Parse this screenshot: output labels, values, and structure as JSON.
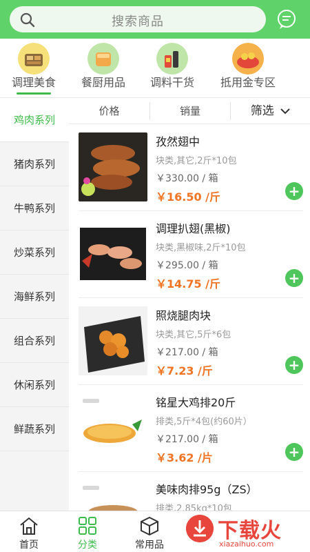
{
  "header": {
    "search_placeholder": "搜索商品"
  },
  "categories": [
    {
      "label": "调理美食",
      "active": true
    },
    {
      "label": "餐厨用品",
      "active": false
    },
    {
      "label": "调料干货",
      "active": false
    },
    {
      "label": "抵用金专区",
      "active": false
    }
  ],
  "sidebar": {
    "items": [
      {
        "label": "鸡肉系列",
        "active": true
      },
      {
        "label": "猪肉系列",
        "active": false
      },
      {
        "label": "牛鸭系列",
        "active": false
      },
      {
        "label": "炒菜系列",
        "active": false
      },
      {
        "label": "海鲜系列",
        "active": false
      },
      {
        "label": "组合系列",
        "active": false
      },
      {
        "label": "休闲系列",
        "active": false
      },
      {
        "label": "鲜蔬系列",
        "active": false
      }
    ]
  },
  "sortbar": {
    "price": "价格",
    "sales": "销量",
    "filter": "筛选"
  },
  "products": [
    {
      "name": "孜然翅中",
      "spec": "块类,其它,2斤*10包",
      "box_price": "￥330.00 / 箱",
      "unit_price": "￥16.50 /斤"
    },
    {
      "name": "调理扒翅(黑椒)",
      "spec": "块类,黑椒味,2斤*10包",
      "box_price": "￥295.00 / 箱",
      "unit_price": "￥14.75 /斤"
    },
    {
      "name": "照烧腿肉块",
      "spec": "块类,其它,5斤*6包",
      "box_price": "￥217.00 / 箱",
      "unit_price": "￥7.23 /斤"
    },
    {
      "name": "铭星大鸡排20斤",
      "spec": "排类,5斤*4包(约60片）",
      "box_price": "￥217.00 / 箱",
      "unit_price": "￥3.62 /片"
    },
    {
      "name": "美味肉排95g（ZS）",
      "spec": "排类,2.85kg*10包",
      "box_price": "",
      "unit_price": ""
    }
  ],
  "bottomnav": [
    {
      "label": "首页",
      "icon": "home-icon",
      "active": false
    },
    {
      "label": "分类",
      "icon": "grid-icon",
      "active": true
    },
    {
      "label": "常用品",
      "icon": "box-icon",
      "active": false
    }
  ],
  "watermark": {
    "title": "下载火",
    "url": "xiazaihuo.com"
  },
  "colors": {
    "brand_green": "#5fd36a",
    "accent_green": "#3dbb4b",
    "price_orange": "#f07423"
  }
}
